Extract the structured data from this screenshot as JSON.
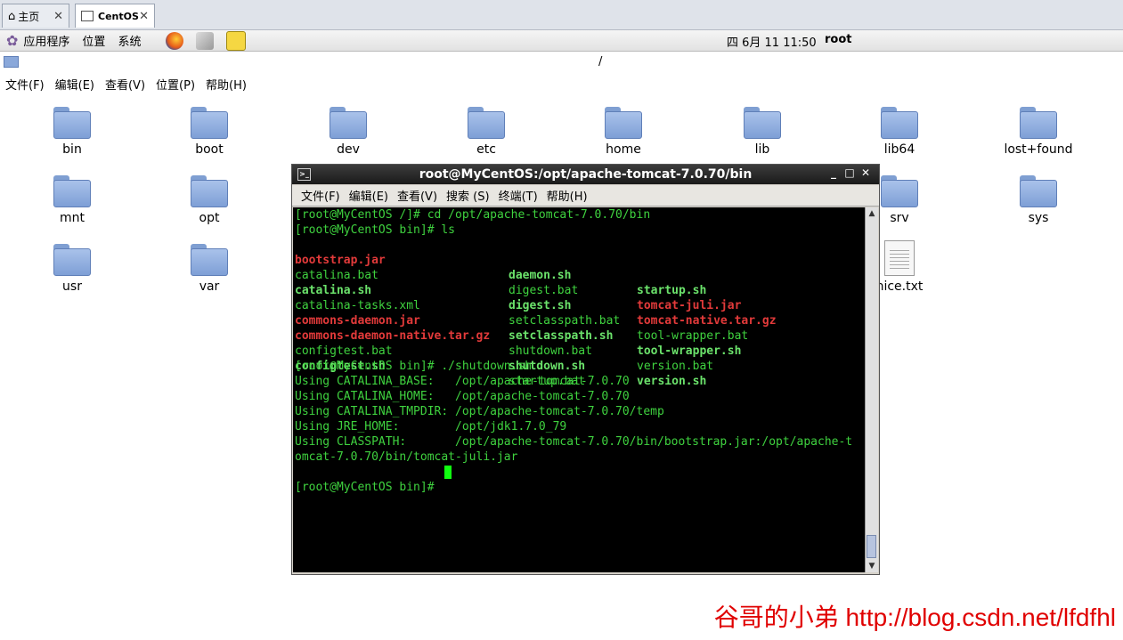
{
  "vm_tabs": [
    {
      "label": "主页",
      "icon": "home-icon",
      "close": "✕"
    },
    {
      "label": "CentOS",
      "icon": "vm-icon",
      "close": "✕"
    }
  ],
  "top_panel": {
    "menus": [
      "应用程序",
      "位置",
      "系统"
    ],
    "launchers": [
      "firefox-icon",
      "mail-icon",
      "notes-icon"
    ],
    "clock": "四 6月 11 11:50",
    "user": "root"
  },
  "file_manager": {
    "path": "/",
    "menu": [
      "文件(F)",
      "编辑(E)",
      "查看(V)",
      "位置(P)",
      "帮助(H)"
    ],
    "items": [
      "bin",
      "boot",
      "dev",
      "etc",
      "home",
      "lib",
      "lib64",
      "lost+found",
      "mnt",
      "opt",
      "srv",
      "sys",
      "usr",
      "var",
      "nice.txt"
    ]
  },
  "terminal": {
    "title": "root@MyCentOS:/opt/apache-tomcat-7.0.70/bin",
    "window_buttons": [
      "_",
      "□",
      "✕"
    ],
    "menu": [
      "文件(F)",
      "编辑(E)",
      "查看(V)",
      "搜索 (S)",
      "终端(T)",
      "帮助(H)"
    ],
    "lines": [
      "[root@MyCentOS /]# cd /opt/apache-tomcat-7.0.70/bin",
      "[root@MyCentOS bin]# ls",
      "",
      "",
      "",
      "",
      "",
      "",
      "",
      "",
      "[root@MyCentOS bin]# ./shutdown.sh",
      "Using CATALINA_BASE:   /opt/apache-tomcat-7.0.70",
      "Using CATALINA_HOME:   /opt/apache-tomcat-7.0.70",
      "Using CATALINA_TMPDIR: /opt/apache-tomcat-7.0.70/temp",
      "Using JRE_HOME:        /opt/jdk1.7.0_79",
      "Using CLASSPATH:       /opt/apache-tomcat-7.0.70/bin/bootstrap.jar:/opt/apache-t",
      "omcat-7.0.70/bin/tomcat-juli.jar",
      "[root@MyCentOS bin]# "
    ],
    "ls_output": [
      [
        "bootstrap.jar",
        "daemon.sh",
        "startup.sh"
      ],
      [
        "catalina.bat",
        "digest.bat",
        "tomcat-juli.jar"
      ],
      [
        "catalina.sh",
        "digest.sh",
        "tomcat-native.tar.gz"
      ],
      [
        "catalina-tasks.xml",
        "setclasspath.bat",
        "tool-wrapper.bat"
      ],
      [
        "commons-daemon.jar",
        "setclasspath.sh",
        "tool-wrapper.sh"
      ],
      [
        "commons-daemon-native.tar.gz",
        "shutdown.bat",
        "version.bat"
      ],
      [
        "configtest.bat",
        "shutdown.sh",
        "version.sh"
      ],
      [
        "configtest.sh",
        "startup.bat",
        ""
      ]
    ]
  },
  "watermark": "谷哥的小弟 http://blog.csdn.net/lfdfhl"
}
